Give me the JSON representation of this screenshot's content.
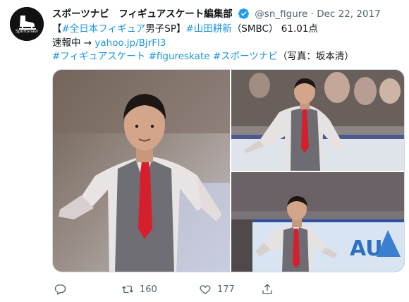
{
  "tweet": {
    "display_name": "スポーツナビ　フィギュアスケート編集部",
    "handle": "@sn_figure",
    "separator": "·",
    "date": "Dec 22, 2017",
    "avatar_text": "Sportsnavi",
    "line1_bracket": "【",
    "line1_hashtag_event": "#全日本フィギュア",
    "line1_event_suffix": "男子SP】",
    "line1_hashtag_name": "#山田耕新",
    "line1_rest": "（SMBC） 61.01点",
    "line2_prefix": "速報中 →",
    "line2_link": "yahoo.jp/BjrFl3",
    "line3_hashtags": "#フィギュアスケート #figureskate #スポーツナビ",
    "line3_credit": "（写真：坂本清）",
    "colors": {
      "link": "#1b95e0",
      "text": "#0f1419",
      "muted": "#536471",
      "verified": "#1d9bf0"
    }
  },
  "actions": {
    "reply_icon": "reply-icon",
    "retweet_icon": "retweet-icon",
    "retweet_count": "160",
    "like_icon": "heart-icon",
    "like_count": "177",
    "share_icon": "share-icon"
  }
}
